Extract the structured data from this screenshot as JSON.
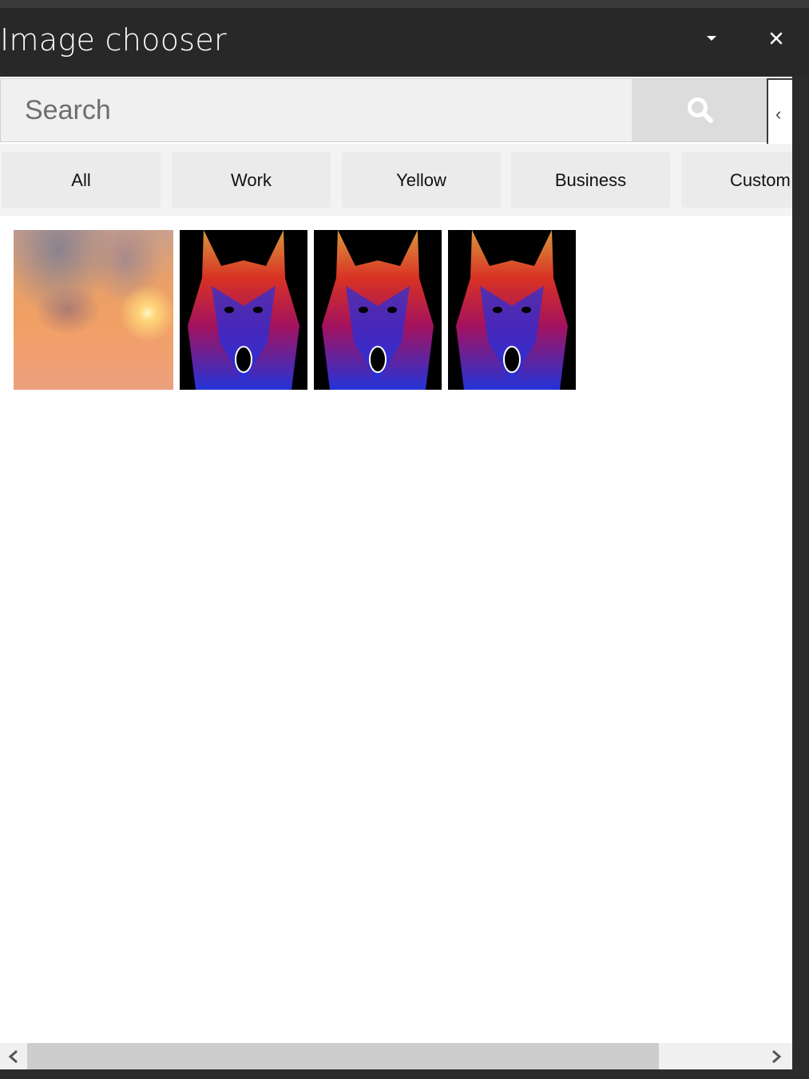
{
  "window": {
    "title": "Image chooser",
    "dropdown_icon": "caret-down-icon",
    "close_icon": "close-icon"
  },
  "search": {
    "placeholder": "Search",
    "value": "",
    "button_icon": "search-icon"
  },
  "collapse_icon": "chevron-left-icon",
  "tabs": [
    {
      "label": "All"
    },
    {
      "label": "Work"
    },
    {
      "label": "Yellow"
    },
    {
      "label": "Business"
    },
    {
      "label": "Custom"
    }
  ],
  "images": [
    {
      "kind": "sunset sky"
    },
    {
      "kind": "neon wolf"
    },
    {
      "kind": "neon wolf"
    },
    {
      "kind": "neon wolf"
    }
  ],
  "scrollbar": {
    "left_icon": "chevron-left-icon",
    "right_icon": "chevron-right-icon",
    "position": 0
  },
  "colors": {
    "titlebar": "#282828",
    "frame": "#2b2b2b",
    "search_bg": "#f0f0f0",
    "search_button": "#dcdcdc",
    "tab_bg": "#ebebeb"
  }
}
